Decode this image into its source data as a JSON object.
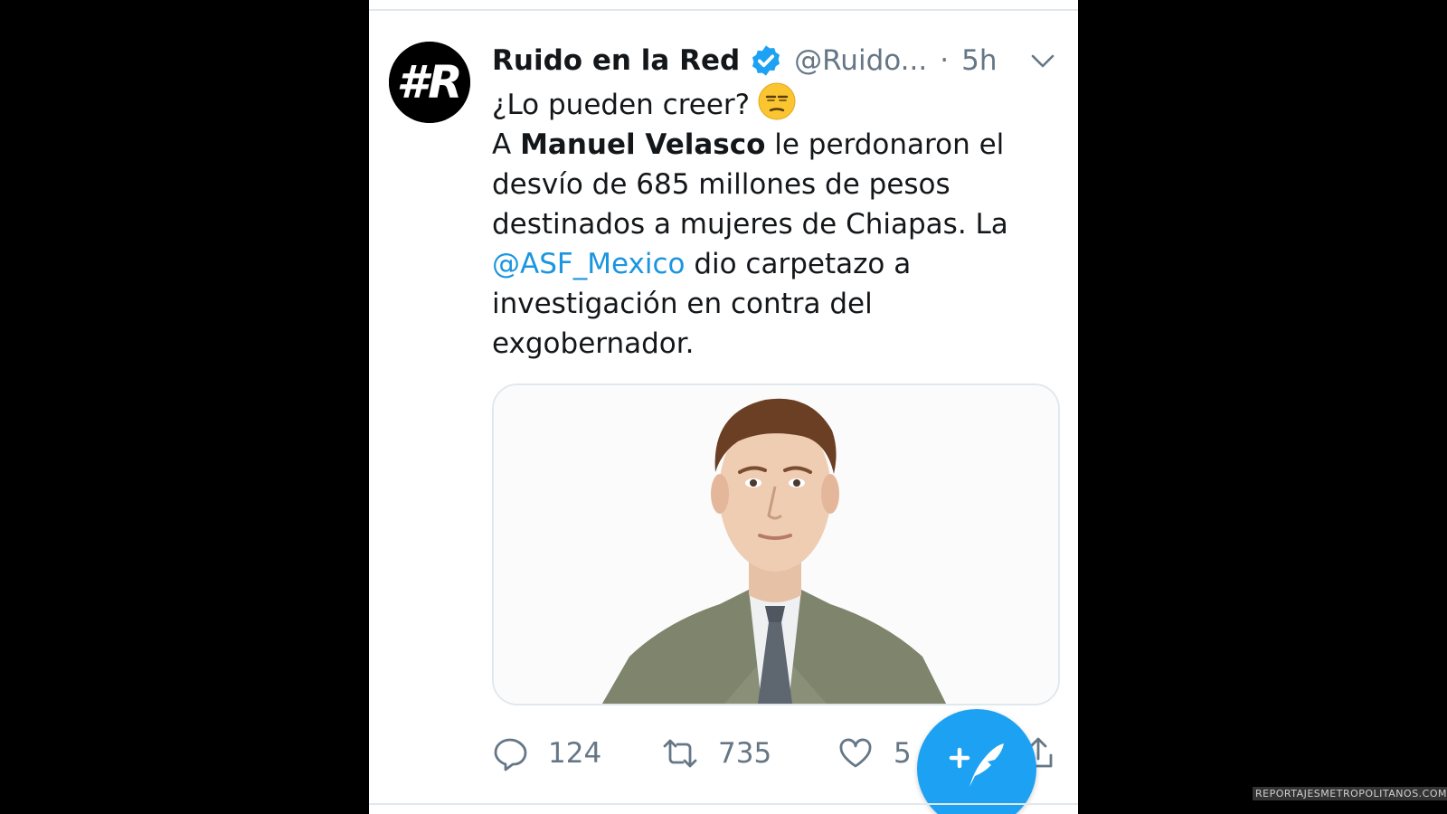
{
  "tweet": {
    "display_name": "Ruido en la Red",
    "handle": "@Ruido...",
    "separator": "·",
    "time": "5h",
    "avatar_icon": "hashtag-r-logo",
    "avatar_text": "#R",
    "verified_icon": "verified-badge-icon",
    "menu_icon": "chevron-down-icon",
    "text": {
      "line1": "¿Lo pueden creer?",
      "line1_emoji": "unamused-face-emoji",
      "prefix": "A ",
      "bold_name": "Manuel Velasco",
      "after_bold": " le perdonaron el desvío de 685 millones de pesos destinados a mujeres de Chiapas. La ",
      "mention": "@ASF_Mexico",
      "after_mention": " dio carpetazo a investigación en contra del exgobernador."
    },
    "media": {
      "description_icon": "portrait-photo"
    },
    "actions": {
      "reply_count": "124",
      "retweet_count": "735",
      "like_count": "5"
    }
  },
  "compose_button_icon": "compose-tweet-icon",
  "watermark": "REPORTAJESMETROPOLITANOS.COM.MX",
  "colors": {
    "accent": "#1da1f2",
    "link": "#1b95e0",
    "text": "#14171a",
    "secondary": "#657786",
    "background": "#000000"
  }
}
